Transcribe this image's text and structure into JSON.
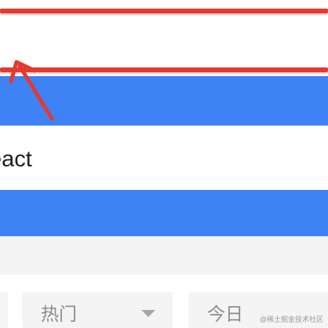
{
  "list": {
    "item_text": "eact"
  },
  "filters": {
    "hot_label": "热门",
    "today_label": "今日"
  },
  "watermark": {
    "text": "@稀土掘金技术社区"
  },
  "colors": {
    "accent_blue": "#3e82f6",
    "annotation_red": "#e23a2f",
    "filter_bg": "#f4f4f4",
    "filter_text": "#8c8c8c"
  }
}
